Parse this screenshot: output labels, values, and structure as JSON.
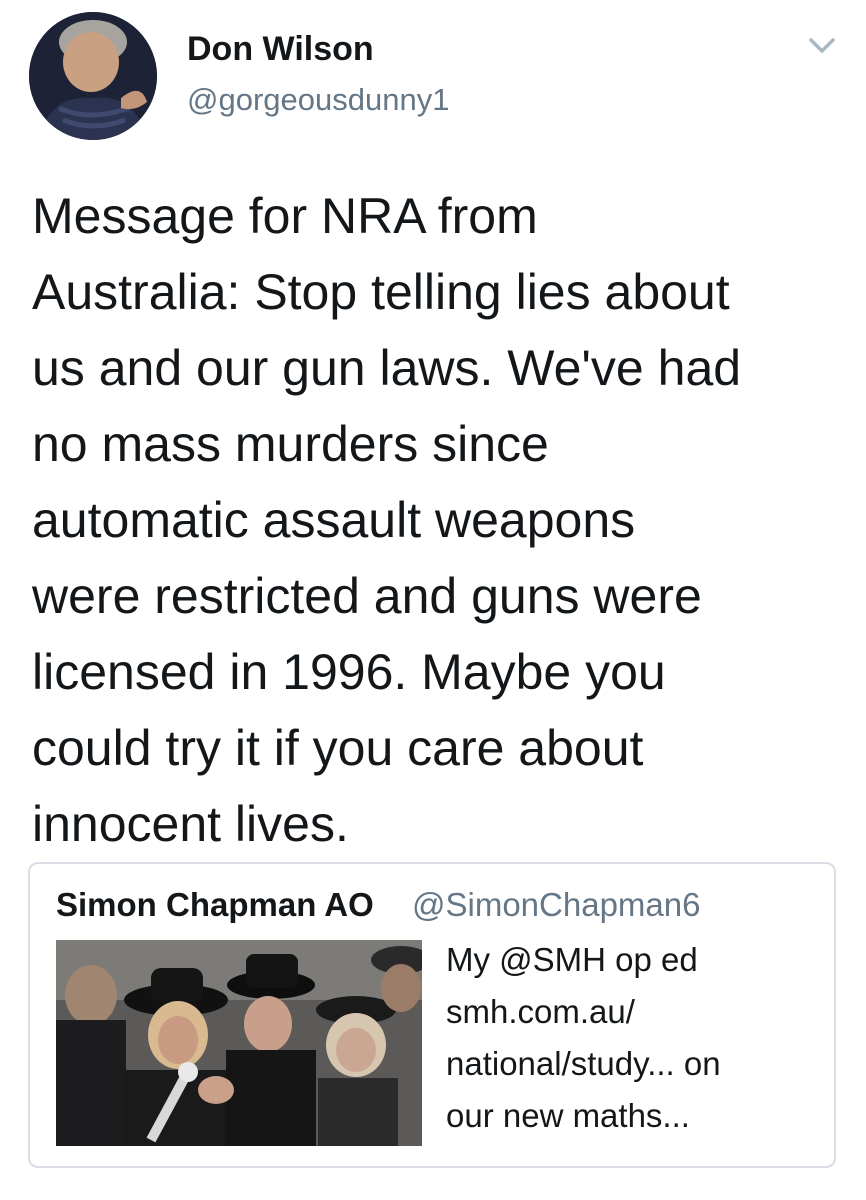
{
  "author": {
    "display_name": "Don Wilson",
    "handle": "@gorgeousdunny1",
    "avatar_icon": "profile-photo"
  },
  "menu_icon": "chevron-down-icon",
  "tweet": {
    "text": "Message for NRA from\nAustralia: Stop telling lies about\nus and our gun laws. We've had\nno mass murders since\nautomatic assault weapons\nwere restricted and guns were\nlicensed in 1996. Maybe you\ncould try it if you care about\ninnocent lives."
  },
  "quoted_tweet": {
    "display_name": "Simon Chapman AO",
    "handle": "@SimonChapman6",
    "text": "My @SMH op ed\nsmh.com.au/\nnational/study... on\nour new maths...",
    "media_icon": "funeral-mourners-photo"
  },
  "colors": {
    "text": "#14171a",
    "secondary": "#657786",
    "border": "#d8dee3"
  }
}
